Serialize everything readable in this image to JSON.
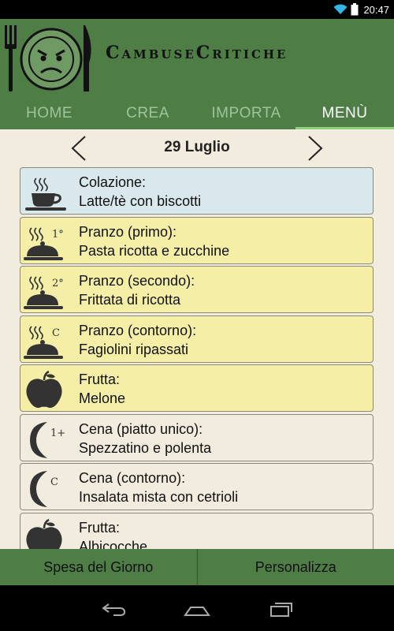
{
  "status_bar": {
    "time": "20:47",
    "icons": [
      "wifi-icon",
      "battery-icon"
    ]
  },
  "app": {
    "title": "CambuseCritiche",
    "logo_icon": "angry-plate-icon"
  },
  "tabs": [
    {
      "label": "HOME",
      "active": false
    },
    {
      "label": "CREA",
      "active": false
    },
    {
      "label": "IMPORTA",
      "active": false
    },
    {
      "label": "MENÙ",
      "active": true
    }
  ],
  "date_nav": {
    "date": "29 Luglio",
    "prev_icon": "chevron-left-icon",
    "next_icon": "chevron-right-icon"
  },
  "meals": [
    {
      "title": "Colazione:",
      "dish": "Latte/tè con biscotti",
      "icon": "coffee-cup-icon",
      "badge": "",
      "kind": "breakfast"
    },
    {
      "title": "Pranzo (primo):",
      "dish": "Pasta ricotta e zucchine",
      "icon": "cloche-icon",
      "badge": "1°",
      "kind": "lunch"
    },
    {
      "title": "Pranzo (secondo):",
      "dish": "Frittata di ricotta",
      "icon": "cloche-icon",
      "badge": "2°",
      "kind": "lunch"
    },
    {
      "title": "Pranzo (contorno):",
      "dish": "Fagiolini ripassati",
      "icon": "cloche-icon",
      "badge": "C",
      "kind": "lunch"
    },
    {
      "title": "Frutta:",
      "dish": "Melone",
      "icon": "apple-icon",
      "badge": "",
      "kind": "lunch"
    },
    {
      "title": "Cena (piatto unico):",
      "dish": "Spezzatino e polenta",
      "icon": "moon-icon",
      "badge": "1+",
      "kind": "dinner"
    },
    {
      "title": "Cena (contorno):",
      "dish": "Insalata mista con cetrioli",
      "icon": "moon-icon",
      "badge": "C",
      "kind": "dinner"
    },
    {
      "title": "Frutta:",
      "dish": "Albicocche",
      "icon": "apple-icon",
      "badge": "",
      "kind": "dinner"
    }
  ],
  "actions": {
    "daily_shopping": "Spesa del Giorno",
    "customize": "Personalizza"
  },
  "system_nav": [
    "back-icon",
    "home-icon",
    "recent-apps-icon"
  ],
  "colors": {
    "header": "#4e7e46",
    "content_bg": "#f1ecdd",
    "breakfast_bg": "#d9e8ec",
    "lunch_bg": "#f5eea6",
    "active_tab_indicator": "#8fd07a"
  }
}
